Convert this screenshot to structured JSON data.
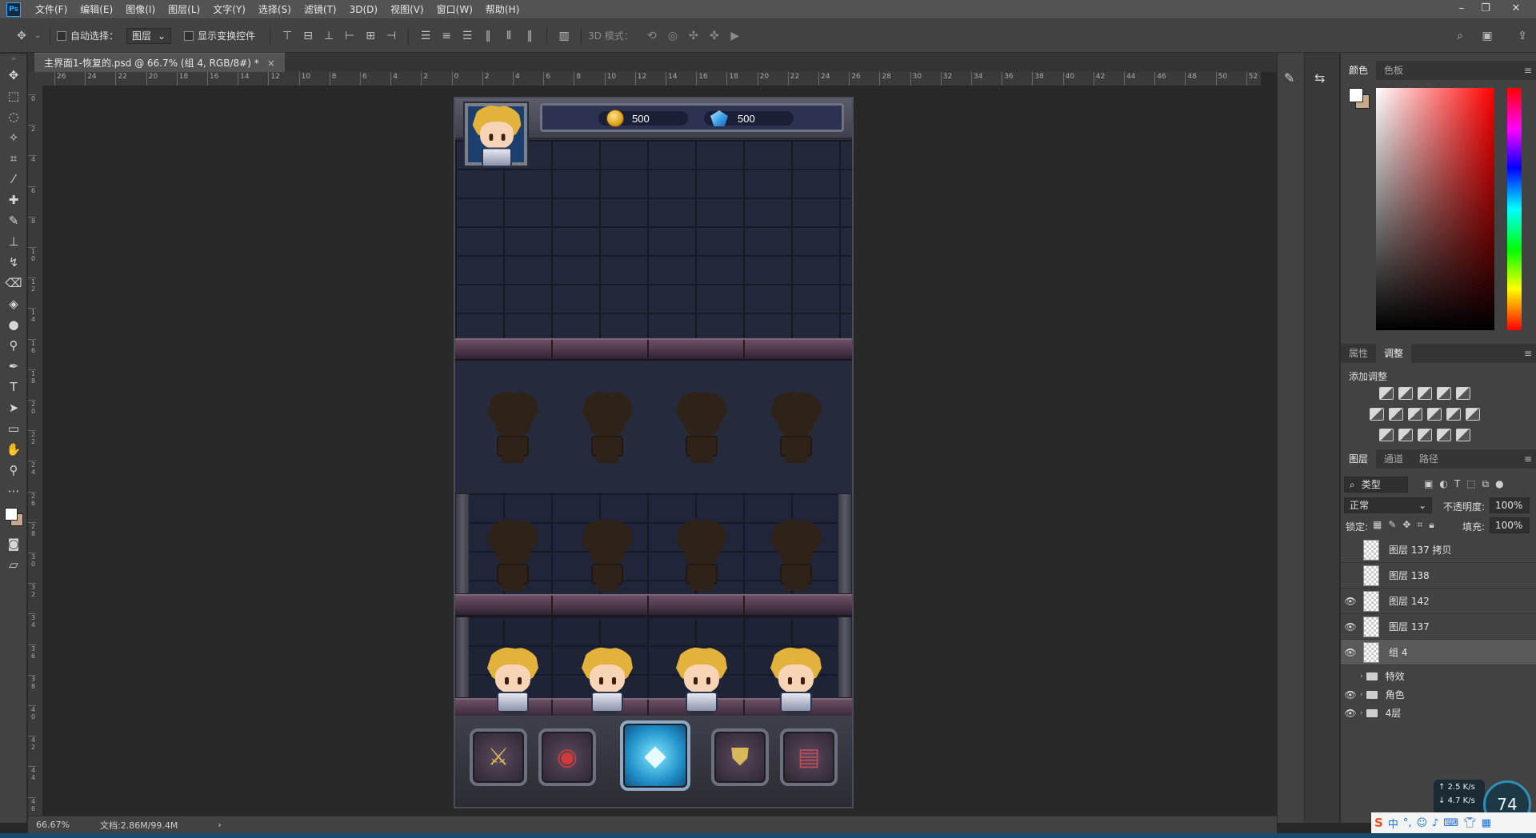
{
  "app": {
    "logo": "Ps"
  },
  "menu": [
    "文件(F)",
    "编辑(E)",
    "图像(I)",
    "图层(L)",
    "文字(Y)",
    "选择(S)",
    "滤镜(T)",
    "3D(D)",
    "视图(V)",
    "窗口(W)",
    "帮助(H)"
  ],
  "window_controls": {
    "minimize": "–",
    "restore": "❐",
    "close": "✕"
  },
  "options": {
    "auto_select_label": "自动选择：",
    "auto_select_value": "图层",
    "show_transform_label": "显示变换控件",
    "mode_3d_label": "3D 模式："
  },
  "document": {
    "tab_title": "主界面1-恢复的.psd @ 66.7% (组 4, RGB/8#) *",
    "tab_close": "×"
  },
  "ruler": {
    "h_labels": [
      "26",
      "24",
      "22",
      "20",
      "18",
      "16",
      "14",
      "12",
      "10",
      "8",
      "6",
      "4",
      "2",
      "0",
      "2",
      "4",
      "6",
      "8",
      "10",
      "12",
      "14",
      "16",
      "18",
      "20",
      "22",
      "24",
      "26",
      "28",
      "30",
      "32",
      "34",
      "36",
      "38",
      "40",
      "42",
      "44",
      "46",
      "48",
      "50",
      "52"
    ],
    "v_labels": [
      "0",
      "2",
      "4",
      "6",
      "8",
      "10",
      "12",
      "14",
      "16",
      "18",
      "20",
      "22",
      "24",
      "26",
      "28",
      "30",
      "32",
      "34",
      "36",
      "38",
      "40",
      "42",
      "44",
      "46"
    ]
  },
  "game": {
    "gold_value": "500",
    "gem_value": "500"
  },
  "panels": {
    "color_tabs": [
      "颜色",
      "色板"
    ],
    "adjust_tabs": [
      "属性",
      "调整"
    ],
    "add_adjustment": "添加调整",
    "layer_tabs": [
      "图层",
      "通道",
      "路径"
    ],
    "filter_kind": "类型",
    "blend_mode": "正常",
    "opacity_label": "不透明度:",
    "opacity_value": "100%",
    "lock_label": "锁定:",
    "fill_label": "填充:",
    "fill_value": "100%",
    "layers": [
      {
        "name": "图层 137 拷贝",
        "visible": false
      },
      {
        "name": "图层 138",
        "visible": false
      },
      {
        "name": "图层 142",
        "visible": true
      },
      {
        "name": "图层 137",
        "visible": true
      },
      {
        "name": "组 4",
        "visible": true,
        "selected": true
      }
    ],
    "groups": [
      {
        "name": "特效",
        "visible": false
      },
      {
        "name": "角色",
        "visible": true
      },
      {
        "name": "4层",
        "visible": true
      }
    ]
  },
  "status": {
    "zoom": "66.67%",
    "doc_info": "文档:2.86M/99.4M",
    "arrow": "›"
  },
  "tray": {
    "ime_label": "中",
    "net_up": "2.5",
    "net_down": "4.7",
    "net_unit": "K/s",
    "perf": "74"
  }
}
